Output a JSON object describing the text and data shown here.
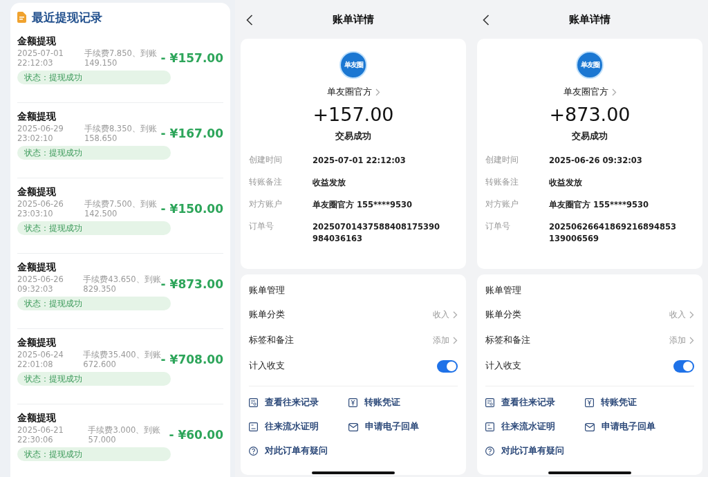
{
  "withdrawals": {
    "title": "最近提现记录",
    "items": [
      {
        "title": "金额提现",
        "date": "2025-07-01",
        "time": "22:12:03",
        "fee": "手续费7.850、到账",
        "received": "149.150",
        "amount": "- ¥157.00",
        "status": "状态：提现成功"
      },
      {
        "title": "金额提现",
        "date": "2025-06-29",
        "time": "23:02:10",
        "fee": "手续费8.350、到账",
        "received": "158.650",
        "amount": "- ¥167.00",
        "status": "状态：提现成功"
      },
      {
        "title": "金额提现",
        "date": "2025-06-26",
        "time": "23:03:10",
        "fee": "手续费7.500、到账",
        "received": "142.500",
        "amount": "- ¥150.00",
        "status": "状态：提现成功"
      },
      {
        "title": "金额提现",
        "date": "2025-06-26",
        "time": "09:32:03",
        "fee": "手续费43.650、到账",
        "received": "829.350",
        "amount": "- ¥873.00",
        "status": "状态：提现成功"
      },
      {
        "title": "金额提现",
        "date": "2025-06-24",
        "time": "22:01:08",
        "fee": "手续费35.400、到账",
        "received": "672.600",
        "amount": "- ¥708.00",
        "status": "状态：提现成功"
      },
      {
        "title": "金额提现",
        "date": "2025-06-21",
        "time": "22:30:06",
        "fee": "手续费3.000、到账",
        "received": "57.000",
        "amount": "- ¥60.00",
        "status": "状态：提现成功"
      }
    ]
  },
  "details": [
    {
      "title": "账单详情",
      "logo_text": "单友圈",
      "payer": "单友圈官方",
      "amount": "+157.00",
      "status": "交易成功",
      "fields": [
        {
          "label": "创建时间",
          "value": "2025-07-01 22:12:03"
        },
        {
          "label": "转账备注",
          "value": "收益发放"
        },
        {
          "label": "对方账户",
          "value": "单友圈官方 155****9530"
        },
        {
          "label": "订单号",
          "value": "20250701437588408175390984036163"
        }
      ],
      "management": {
        "title": "账单管理",
        "rows": [
          {
            "kind": "link",
            "label": "账单分类",
            "value": "收入"
          },
          {
            "kind": "link",
            "label": "标签和备注",
            "value": "添加"
          },
          {
            "kind": "toggle",
            "label": "计入收支",
            "on": true
          }
        ]
      },
      "actions": [
        "查看往来记录",
        "转账凭证",
        "往来流水证明",
        "申请电子回单",
        "对此订单有疑问"
      ]
    },
    {
      "title": "账单详情",
      "logo_text": "单友圈",
      "payer": "单友圈官方",
      "amount": "+873.00",
      "status": "交易成功",
      "fields": [
        {
          "label": "创建时间",
          "value": "2025-06-26 09:32:03"
        },
        {
          "label": "转账备注",
          "value": "收益发放"
        },
        {
          "label": "对方账户",
          "value": "单友圈官方 155****9530"
        },
        {
          "label": "订单号",
          "value": "20250626641869216894853139006569"
        }
      ],
      "management": {
        "title": "账单管理",
        "rows": [
          {
            "kind": "link",
            "label": "账单分类",
            "value": "收入"
          },
          {
            "kind": "link",
            "label": "标签和备注",
            "value": "添加"
          },
          {
            "kind": "toggle",
            "label": "计入收支",
            "on": true
          }
        ]
      },
      "actions": [
        "查看往来记录",
        "转账凭证",
        "往来流水证明",
        "申请电子回单",
        "对此订单有疑问"
      ]
    }
  ]
}
